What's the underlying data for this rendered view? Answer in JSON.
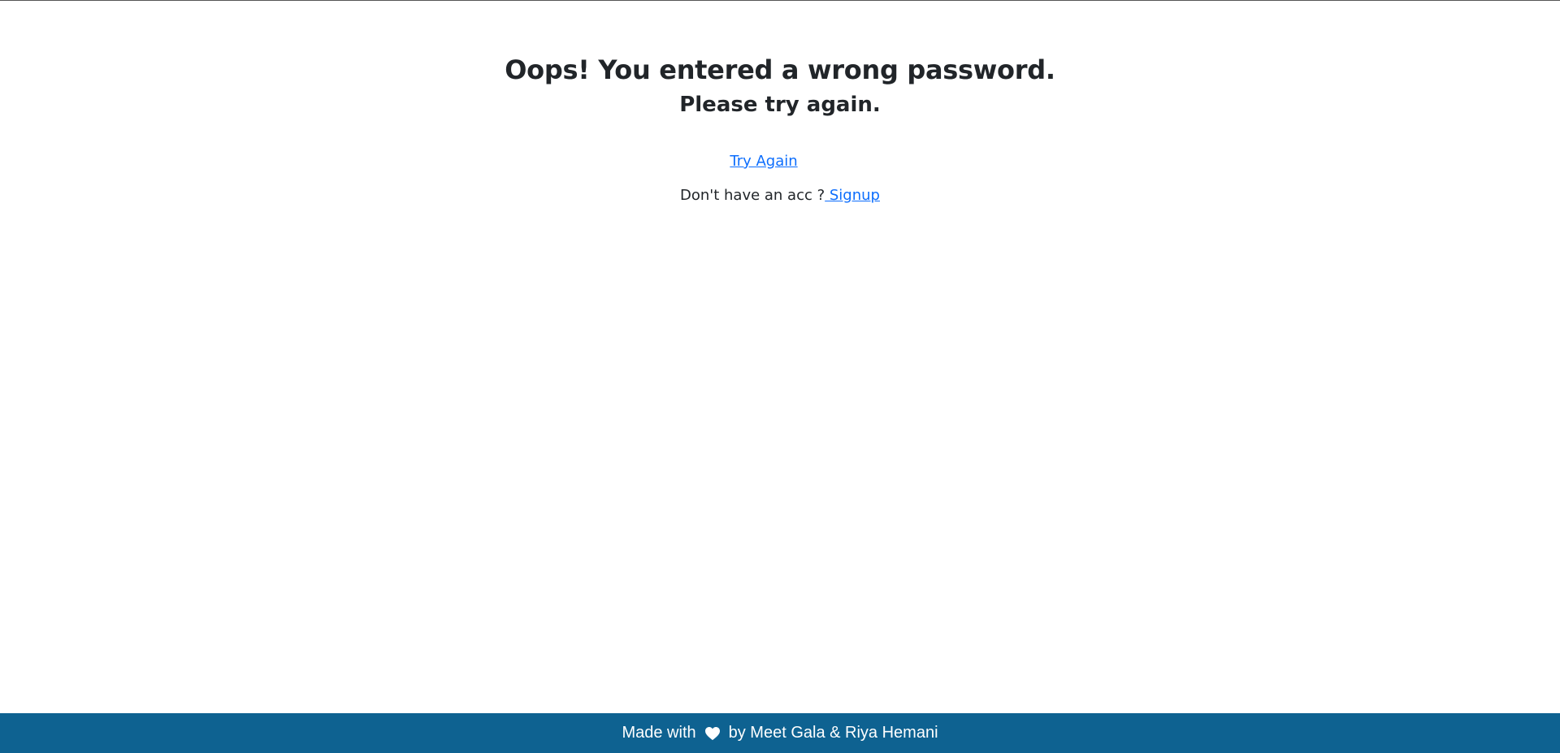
{
  "message": {
    "headline": "Oops! You entered a wrong password.",
    "subline": "Please try again."
  },
  "actions": {
    "try_again_label": "Try Again",
    "signup_prompt": "Don't have an acc ?",
    "signup_label": " Signup"
  },
  "footer": {
    "prefix": "Made with",
    "icon": "heart-icon",
    "suffix": "by Meet Gala & Riya Hemani",
    "background_color": "#0e6291",
    "text_color": "#ffffff"
  },
  "colors": {
    "link": "#0d6efd",
    "text": "#212529"
  }
}
